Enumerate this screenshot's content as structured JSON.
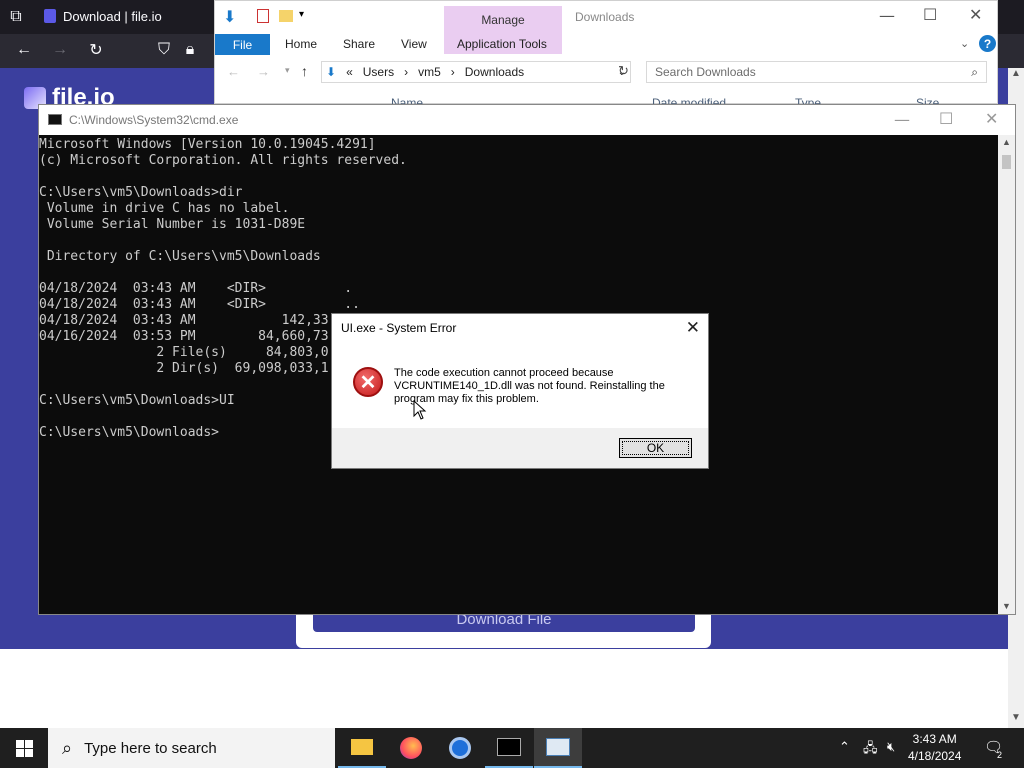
{
  "browser": {
    "tab_title": "Download | file.io",
    "site_name": "file.io",
    "download_button": "Download File"
  },
  "explorer": {
    "manage_label": "Manage",
    "window_title": "Downloads",
    "tabs": [
      "File",
      "Home",
      "Share",
      "View",
      "Application Tools"
    ],
    "address": {
      "sep": "«",
      "parts": [
        "Users",
        "vm5",
        "Downloads"
      ]
    },
    "search_placeholder": "Search Downloads",
    "columns": [
      "Name",
      "Date modified",
      "Type",
      "Size"
    ]
  },
  "cmd": {
    "title": "C:\\Windows\\System32\\cmd.exe",
    "lines": [
      "Microsoft Windows [Version 10.0.19045.4291]",
      "(c) Microsoft Corporation. All rights reserved.",
      "",
      "C:\\Users\\vm5\\Downloads>dir",
      " Volume in drive C has no label.",
      " Volume Serial Number is 1031-D89E",
      "",
      " Directory of C:\\Users\\vm5\\Downloads",
      "",
      "04/18/2024  03:43 AM    <DIR>          .",
      "04/18/2024  03:43 AM    <DIR>          ..",
      "04/18/2024  03:43 AM           142,33",
      "04/16/2024  03:53 PM        84,660,73                                    er_x64.exe",
      "               2 File(s)     84,803,0",
      "               2 Dir(s)  69,098,033,1",
      "",
      "C:\\Users\\vm5\\Downloads>UI",
      "",
      "C:\\Users\\vm5\\Downloads>"
    ]
  },
  "dialog": {
    "title": "UI.exe - System Error",
    "message": "The code execution cannot proceed because VCRUNTIME140_1D.dll was not found. Reinstalling the program may fix this problem.",
    "ok_label": "OK"
  },
  "taskbar": {
    "search_placeholder": "Type here to search",
    "time": "3:43 AM",
    "date": "4/18/2024",
    "notification_count": "2"
  }
}
